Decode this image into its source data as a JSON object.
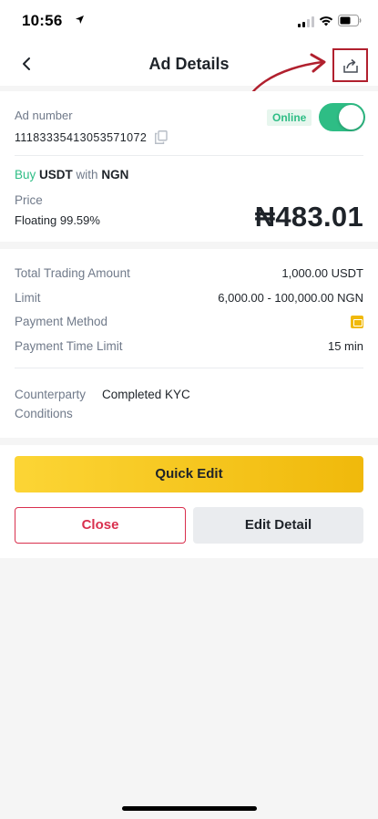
{
  "status_bar": {
    "time": "10:56"
  },
  "header": {
    "title": "Ad Details"
  },
  "ad": {
    "number_label": "Ad number",
    "number": "11183335413053571072",
    "status": "Online",
    "online": true
  },
  "trade": {
    "side": "Buy",
    "asset": "USDT",
    "with_word": "with",
    "fiat": "NGN"
  },
  "price": {
    "label": "Price",
    "type": "Floating 99.59%",
    "value": "₦483.01"
  },
  "details": {
    "total_label": "Total Trading Amount",
    "total_value": "1,000.00 USDT",
    "limit_label": "Limit",
    "limit_value": "6,000.00 - 100,000.00 NGN",
    "payment_label": "Payment Method",
    "time_label": "Payment Time Limit",
    "time_value": "15 min",
    "counterparty_label": "Counterparty Conditions",
    "counterparty_value": "Completed KYC"
  },
  "actions": {
    "quick_edit": "Quick Edit",
    "close": "Close",
    "edit_detail": "Edit Detail"
  },
  "colors": {
    "accent_yellow": "#F0B90B",
    "online_green": "#2EBD85",
    "close_red": "#D9304E",
    "annotation_red": "#B1202E"
  },
  "icons": {
    "back": "chevron-left-icon",
    "share": "share-icon",
    "copy": "copy-icon",
    "payment": "payment-method-icon"
  }
}
